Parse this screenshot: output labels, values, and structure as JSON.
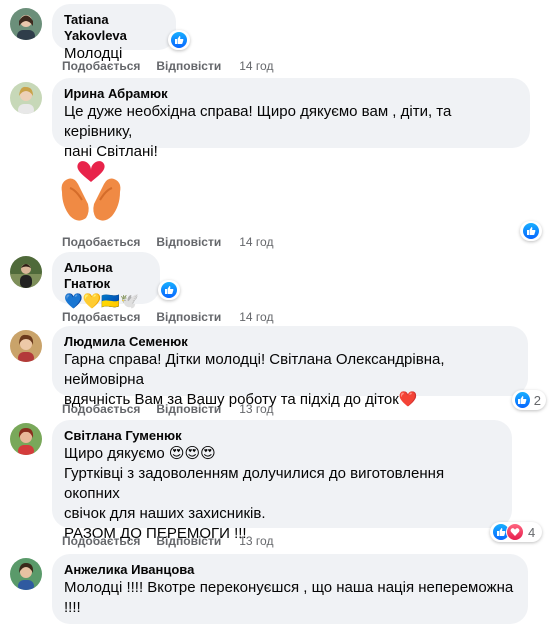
{
  "actions": {
    "like": "Подобається",
    "reply": "Відповісти"
  },
  "comments": [
    {
      "author": "Tatiana Yakovleva",
      "text": "Молодці",
      "time": "14 год"
    },
    {
      "author": "Ирина Абрамюк",
      "text": "Це дуже необхідна справа! Щиро дякуємо вам , діти, та керівнику,\nпані Світлані!",
      "time": "14 год"
    },
    {
      "author": "Альона Гнатюк",
      "text": "💙💛🇺🇦🕊️",
      "time": "14 год"
    },
    {
      "author": "Людмила Семенюк",
      "text": "Гарна справа! Дітки молодці! Світлана Олександрівна, неймовірна\nвдячність Вам за Вашу роботу та підхід до діток❤️",
      "time": "13 год",
      "reactions": "2"
    },
    {
      "author": "Світлана Гуменюк",
      "text": "Щиро дякуємо 😍😍😍\nГуртківці з задоволенням долучилися до виготовлення окопних\nсвічок для наших захисників.\nРАЗОМ ДО ПЕРЕМОГИ !!!",
      "time": "13 год",
      "reactions": "4"
    },
    {
      "author": "Анжелика Иванцова",
      "text": "Молодці !!!! Вкотре переконуєшся , що наша нація непереможна\n!!!!"
    }
  ],
  "colors": {
    "bubble": "#f0f2f5",
    "like": "#0866ff",
    "love": "#e61e4d",
    "meta": "#65676b"
  }
}
